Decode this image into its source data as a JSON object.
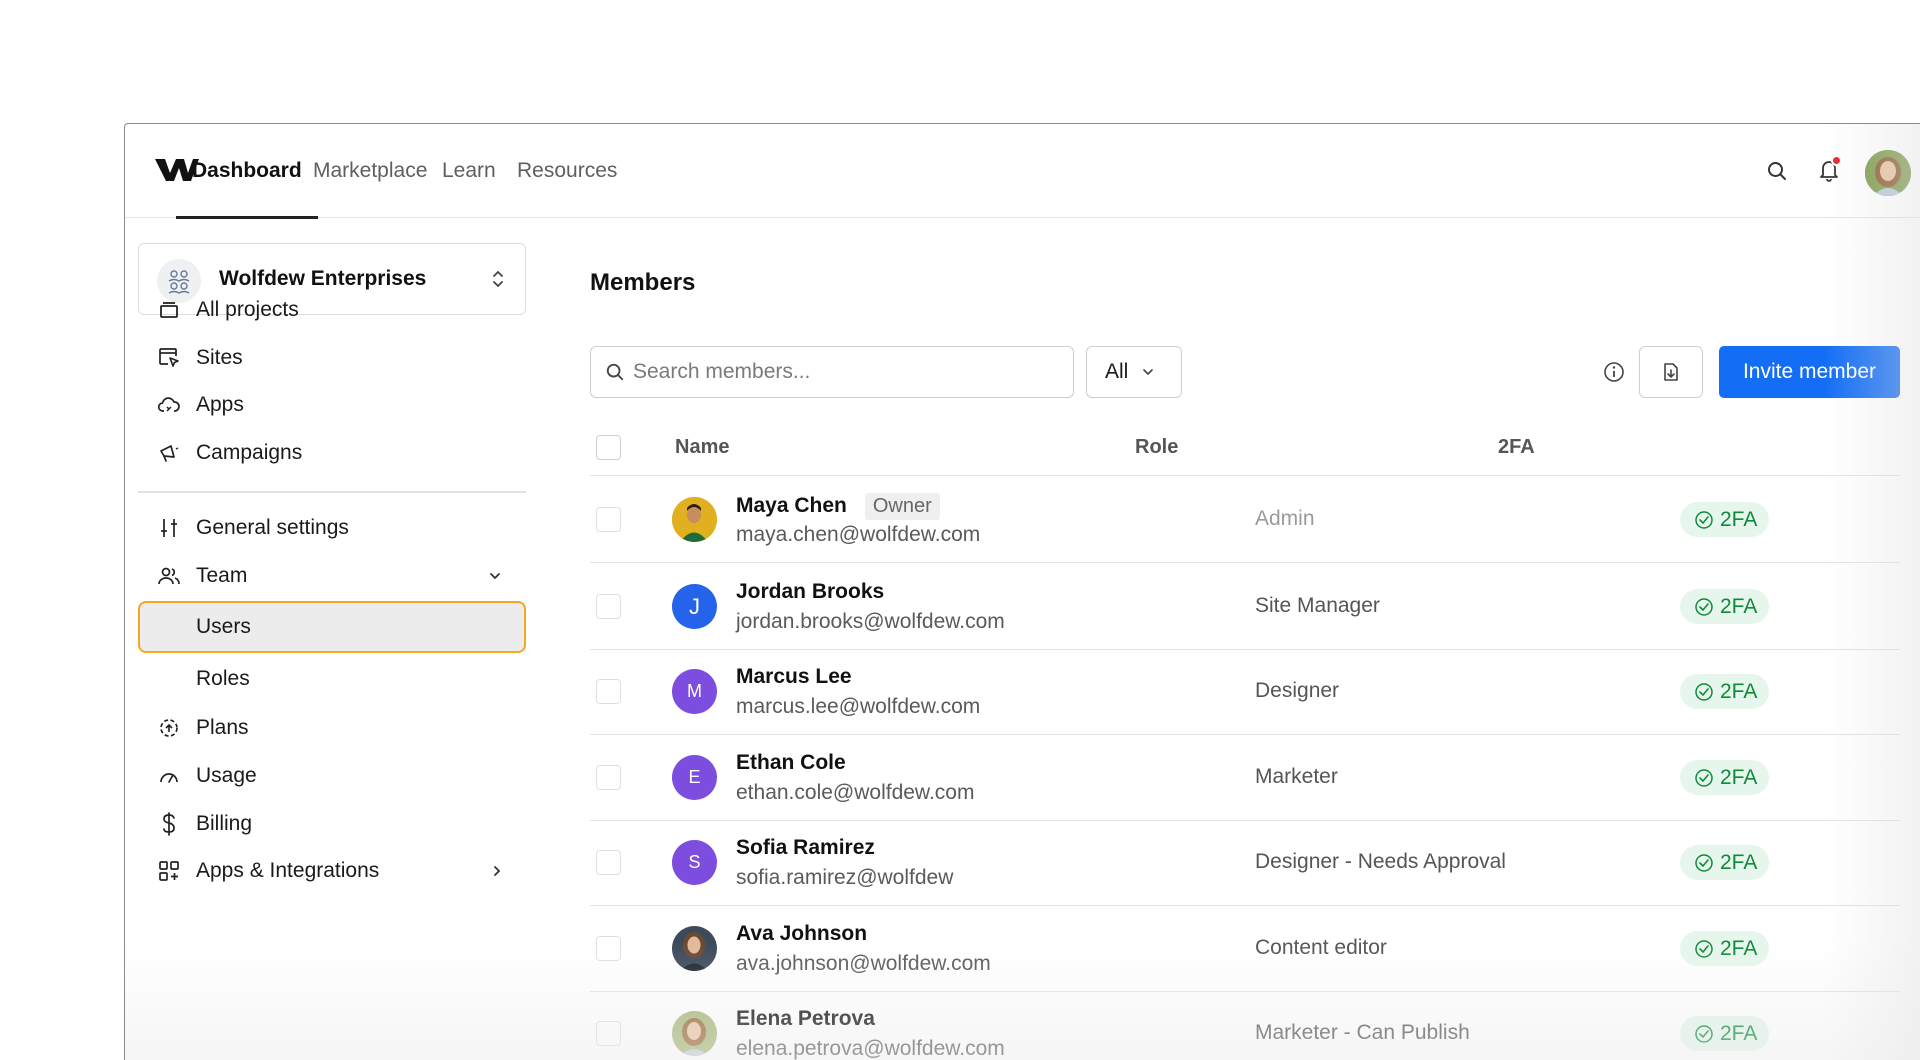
{
  "nav": {
    "tabs": [
      {
        "label": "Dashboard",
        "active": true
      },
      {
        "label": "Marketplace"
      },
      {
        "label": "Learn"
      },
      {
        "label": "Resources"
      }
    ],
    "icons": [
      "search-icon",
      "bell-icon",
      "user-avatar"
    ],
    "notification_dot_color": "#e5232b"
  },
  "workspace": {
    "name": "Wolfdew Enterprises"
  },
  "sidebar": {
    "items": [
      {
        "label": "All projects",
        "icon": "folder-icon"
      },
      {
        "label": "Sites",
        "icon": "site-cursor-icon"
      },
      {
        "label": "Apps",
        "icon": "cloud-apps-icon"
      },
      {
        "label": "Campaigns",
        "icon": "megaphone-icon"
      },
      {
        "label": "General settings",
        "icon": "sliders-icon"
      },
      {
        "label": "Team",
        "icon": "team-icon",
        "expanded": true
      },
      {
        "label": "Users",
        "selected": true
      },
      {
        "label": "Roles"
      },
      {
        "label": "Plans",
        "icon": "plans-icon"
      },
      {
        "label": "Usage",
        "icon": "gauge-icon"
      },
      {
        "label": "Billing",
        "icon": "dollar-icon"
      },
      {
        "label": "Apps & Integrations",
        "icon": "integrations-icon"
      }
    ]
  },
  "main": {
    "title": "Members",
    "search_placeholder": "Search members...",
    "filter_value": "All",
    "invite_label": "Invite member",
    "accent_color": "#146ef5",
    "columns": {
      "name": "Name",
      "role": "Role",
      "twofa": "2FA"
    },
    "members": [
      {
        "name": "Maya Chen",
        "badge": "Owner",
        "email": "maya.chen@wolfdew.com",
        "role": "Admin",
        "twofa": "2FA",
        "avatar": "photo"
      },
      {
        "name": "Jordan Brooks",
        "email": "jordan.brooks@wolfdew.com",
        "role": "Site Manager",
        "twofa": "2FA",
        "initial": "J",
        "avatar_color": "#2563eb"
      },
      {
        "name": "Marcus Lee",
        "email": "marcus.lee@wolfdew.com",
        "role": "Designer",
        "twofa": "2FA",
        "initial": "M",
        "avatar_color": "#7c4ddf"
      },
      {
        "name": "Ethan Cole",
        "email": "ethan.cole@wolfdew.com",
        "role": "Marketer",
        "twofa": "2FA",
        "initial": "E",
        "avatar_color": "#7c4ddf"
      },
      {
        "name": "Sofia Ramirez",
        "email": "sofia.ramirez@wolfdew",
        "role": "Designer - Needs Approval",
        "twofa": "2FA",
        "initial": "S",
        "avatar_color": "#7c4ddf"
      },
      {
        "name": "Ava Johnson",
        "email": "ava.johnson@wolfdew.com",
        "role": "Content editor",
        "twofa": "2FA",
        "avatar": "photo"
      },
      {
        "name": "Elena Petrova",
        "email": "elena.petrova@wolfdew.com",
        "role": "Marketer - Can Publish",
        "twofa": "2FA",
        "avatar": "photo"
      }
    ]
  }
}
